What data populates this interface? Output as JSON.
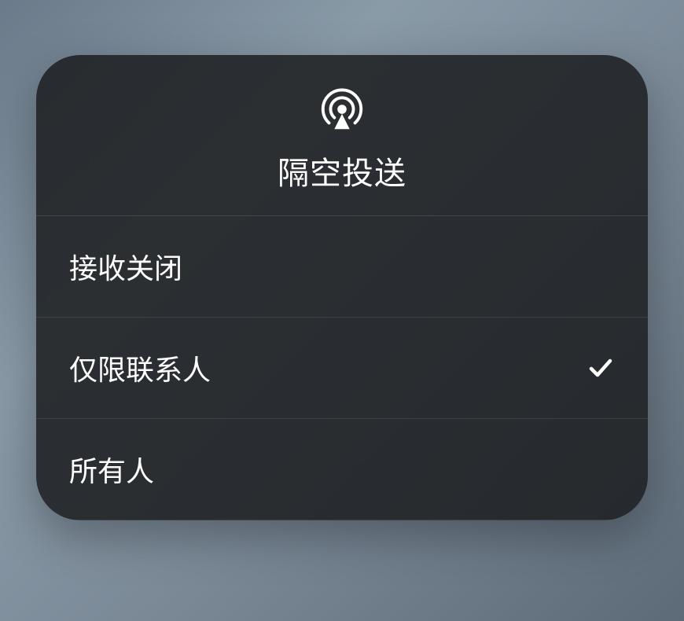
{
  "panel": {
    "title": "隔空投送",
    "options": [
      {
        "label": "接收关闭",
        "selected": false
      },
      {
        "label": "仅限联系人",
        "selected": true
      },
      {
        "label": "所有人",
        "selected": false
      }
    ]
  }
}
